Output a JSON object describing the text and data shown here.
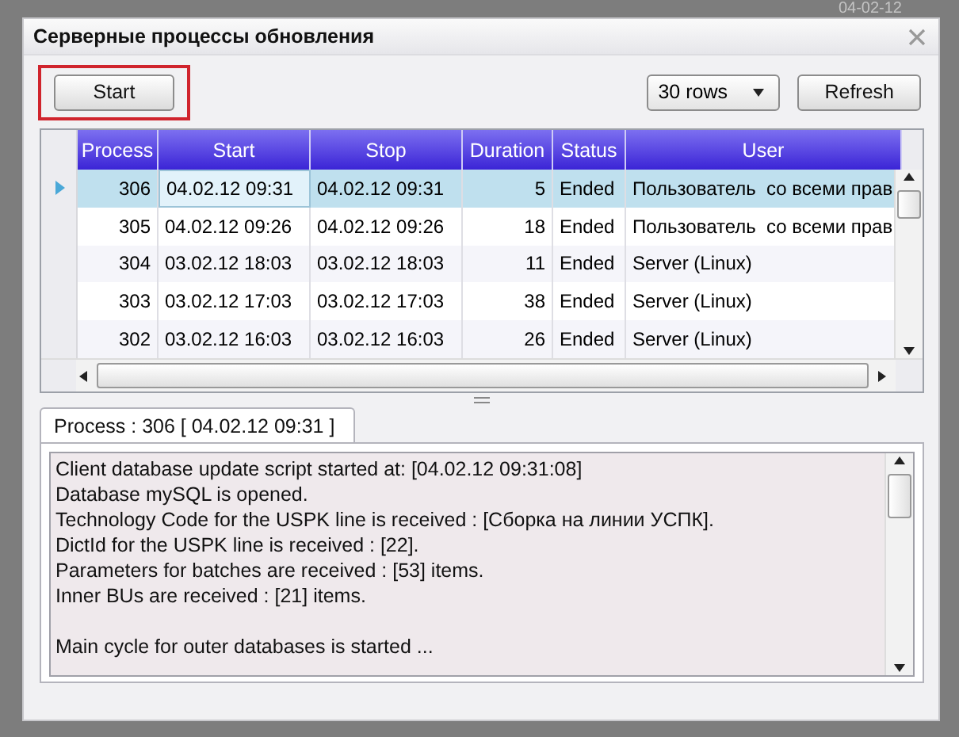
{
  "background": {
    "text": "04-02-12"
  },
  "window": {
    "title": "Серверные процессы обновления"
  },
  "toolbar": {
    "start_button": {
      "label": "Start",
      "highlighted": true
    },
    "rows_select": {
      "value": "30 rows"
    },
    "refresh_button": {
      "label": "Refresh"
    }
  },
  "table": {
    "columns": [
      "Process",
      "Start",
      "Stop",
      "Duration",
      "Status",
      "User"
    ],
    "rows": [
      {
        "selected": true,
        "cells": [
          "306",
          "04.02.12 09:31",
          "04.02.12 09:31",
          "5",
          "Ended",
          "Пользователь  со всеми прав"
        ]
      },
      {
        "selected": false,
        "cells": [
          "305",
          "04.02.12 09:26",
          "04.02.12 09:26",
          "18",
          "Ended",
          "Пользователь  со всеми прав"
        ]
      },
      {
        "selected": false,
        "cells": [
          "304",
          "03.02.12 18:03",
          "03.02.12 18:03",
          "11",
          "Ended",
          "Server (Linux)"
        ]
      },
      {
        "selected": false,
        "cells": [
          "303",
          "03.02.12 17:03",
          "03.02.12 17:03",
          "38",
          "Ended",
          "Server (Linux)"
        ]
      },
      {
        "selected": false,
        "cells": [
          "302",
          "03.02.12 16:03",
          "03.02.12 16:03",
          "26",
          "Ended",
          "Server (Linux)"
        ]
      }
    ]
  },
  "tabs": [
    {
      "label": "Process : 306 [ 04.02.12 09:31 ]",
      "selected": true
    }
  ],
  "log": {
    "paragraphs": [
      {
        "lines": [
          "Client database update script started at: [04.02.12 09:31:08]",
          "Database mySQL is opened.",
          "Technology Code for the USPK line is received : [Сборка на линии УСПК].",
          "DictId for the USPK line is received : [22].",
          "Parameters for batches are received : [53] items.",
          "Inner BUs are received : [21] items."
        ]
      },
      {
        "lines": [
          "Main cycle for outer databases is started ..."
        ]
      }
    ]
  }
}
